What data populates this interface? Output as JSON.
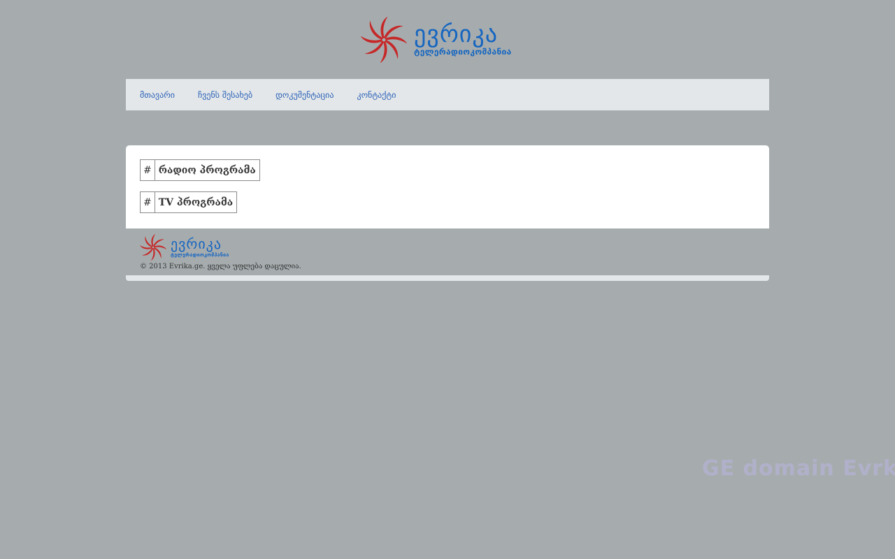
{
  "header": {
    "logo_title": "ევრიკა",
    "logo_subtitle": "ტელერადიოკომპანია"
  },
  "nav": {
    "items": [
      {
        "label": "მთავარი"
      },
      {
        "label": "ჩვენს შესახებ"
      },
      {
        "label": "დოკუმენტაცია"
      },
      {
        "label": "კონტაქტი"
      }
    ]
  },
  "content": {
    "tables": [
      {
        "num": "#",
        "label": "რადიო პროგრამა"
      },
      {
        "num": "#",
        "label": "TV პროგრამა"
      }
    ]
  },
  "footer": {
    "logo_title": "ევრიკა",
    "logo_subtitle": "ტელერადიოკომპანია",
    "copyright": "© 2013 Evrika.ge. ყველა უფლება დაცულია."
  },
  "watermark": {
    "text": "GE domain Evrk"
  },
  "colors": {
    "background": "#a6acae",
    "accent": "#1565c0",
    "logo_red": "#c62828",
    "nav_bg": "#e4e7e9"
  },
  "icons": {
    "logo": "swirl-logo-icon"
  }
}
